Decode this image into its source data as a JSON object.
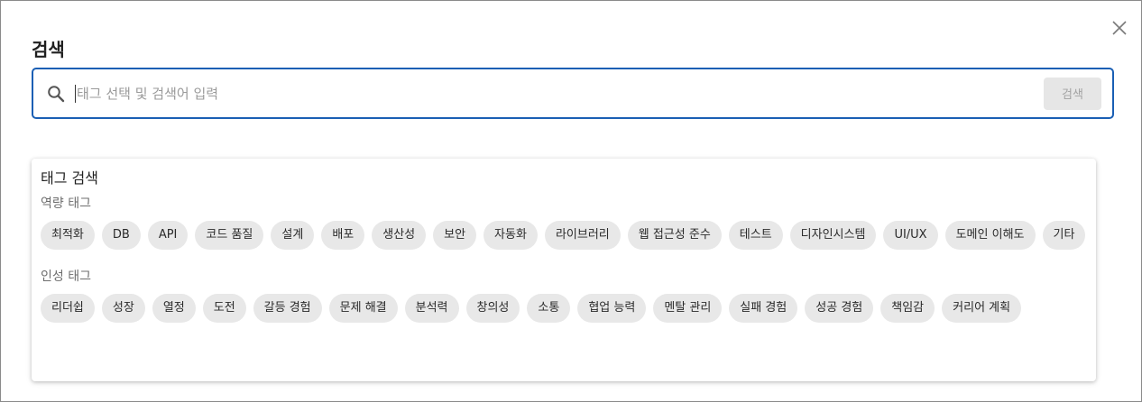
{
  "dialog": {
    "title": "검색",
    "close_icon": "close-icon"
  },
  "search": {
    "placeholder": "태그 선택 및 검색어 입력",
    "value": "",
    "submit_label": "검색",
    "icon": "search-icon"
  },
  "tag_panel": {
    "title": "태그 검색",
    "groups": [
      {
        "label": "역량 태그",
        "tags": [
          "최적화",
          "DB",
          "API",
          "코드 품질",
          "설계",
          "배포",
          "생산성",
          "보안",
          "자동화",
          "라이브러리",
          "웹 접근성 준수",
          "테스트",
          "디자인시스템",
          "UI/UX",
          "도메인 이해도",
          "기타"
        ]
      },
      {
        "label": "인성 태그",
        "tags": [
          "리더쉽",
          "성장",
          "열정",
          "도전",
          "갈등 경험",
          "문제 해결",
          "분석력",
          "창의성",
          "소통",
          "협업 능력",
          "멘탈 관리",
          "실패 경험",
          "성공 경험",
          "책임감",
          "커리어 계획"
        ]
      }
    ]
  },
  "colors": {
    "accent": "#1a5fb4",
    "chip_bg": "#e8e8e8",
    "muted_text": "#6e6e6e"
  }
}
